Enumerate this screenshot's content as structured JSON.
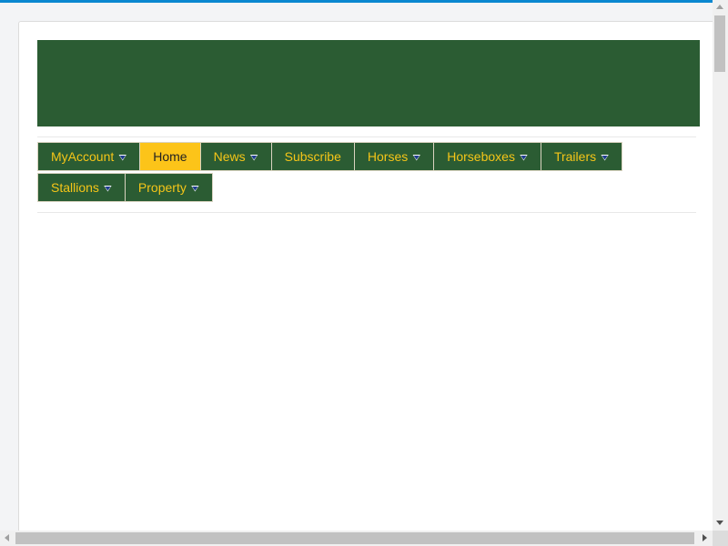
{
  "colors": {
    "topbar": "#0a87d0",
    "banner": "#2b5c33",
    "nav_bg": "#2b5c33",
    "nav_text": "#f5c518",
    "nav_active_bg": "#fcc419",
    "nav_active_text": "#222222"
  },
  "nav": {
    "items": [
      {
        "label": "MyAccount",
        "has_dropdown": true,
        "active": false
      },
      {
        "label": "Home",
        "has_dropdown": false,
        "active": true
      },
      {
        "label": "News",
        "has_dropdown": true,
        "active": false
      },
      {
        "label": "Subscribe",
        "has_dropdown": false,
        "active": false
      },
      {
        "label": "Horses",
        "has_dropdown": true,
        "active": false
      },
      {
        "label": "Horseboxes",
        "has_dropdown": true,
        "active": false
      },
      {
        "label": "Trailers",
        "has_dropdown": true,
        "active": false
      },
      {
        "label": "Stallions",
        "has_dropdown": true,
        "active": false
      },
      {
        "label": "Property",
        "has_dropdown": true,
        "active": false
      }
    ],
    "dropdown_icon": "chevron-down-icon"
  }
}
